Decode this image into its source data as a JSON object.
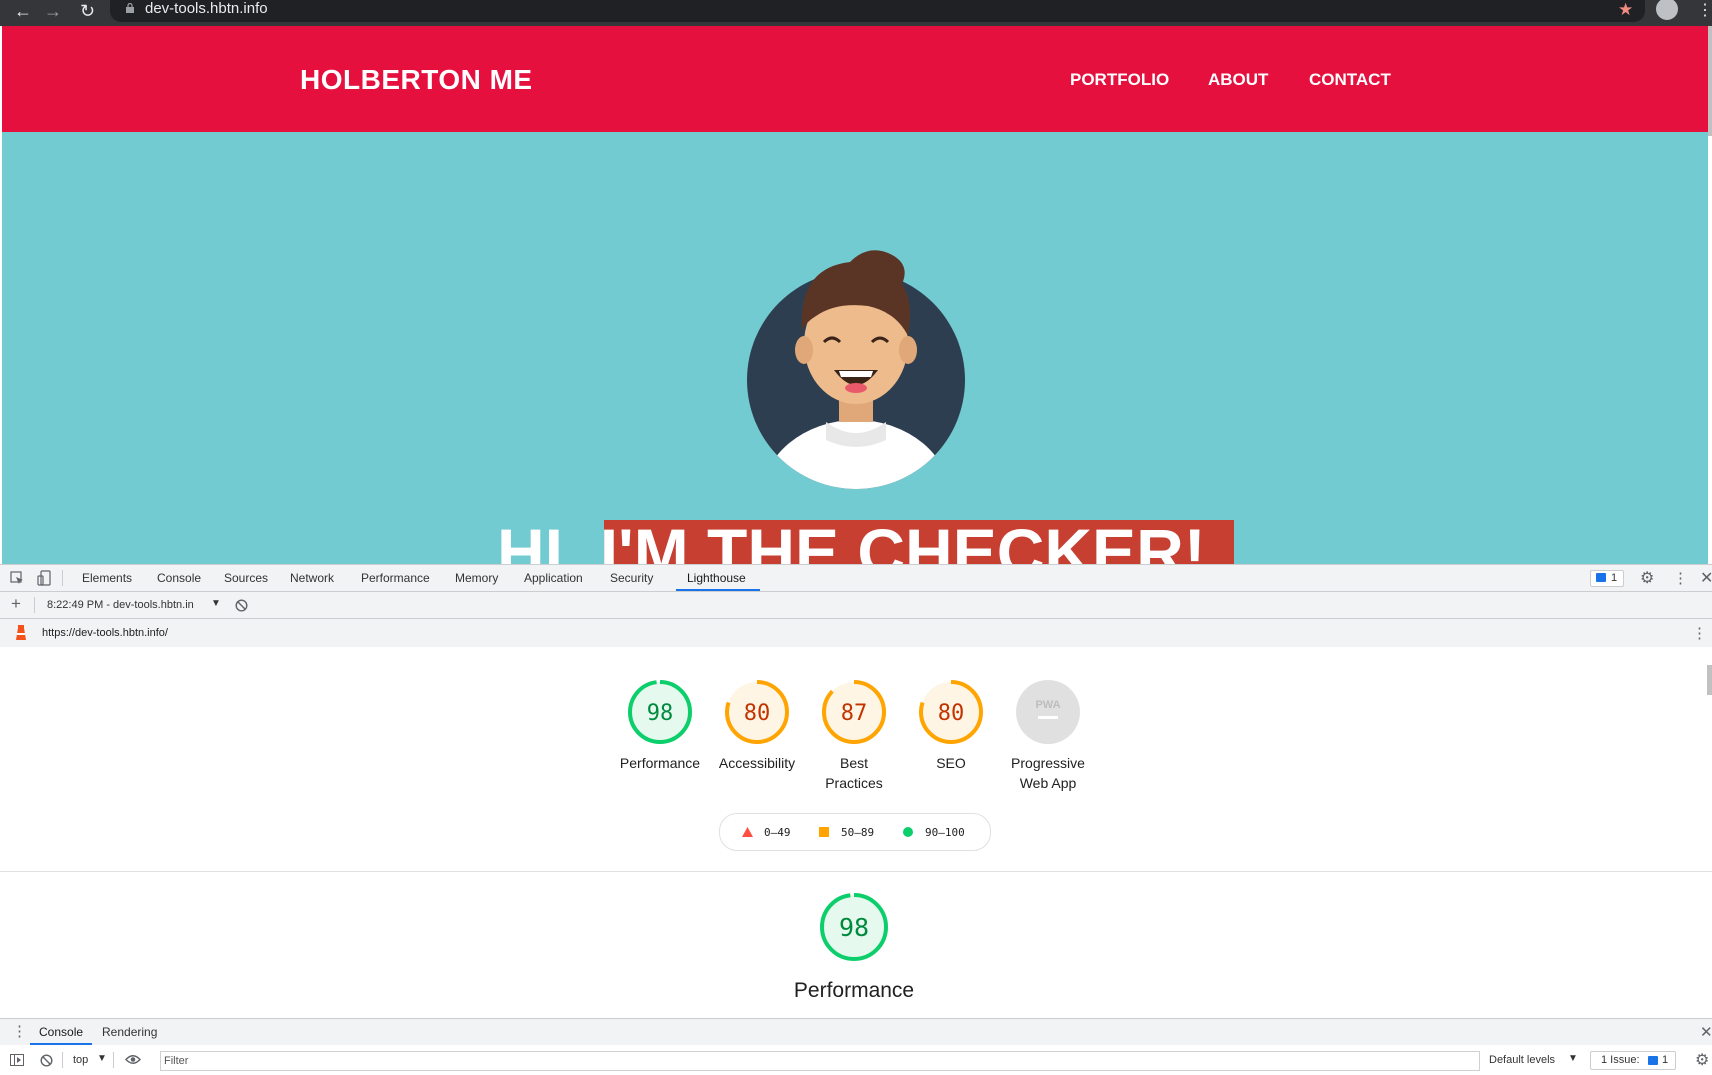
{
  "browser": {
    "url": "dev-tools.hbtn.info",
    "nav": {
      "back": "←",
      "forward": "→",
      "reload": "↻"
    }
  },
  "site": {
    "logo": "HOLBERTON ME",
    "nav": [
      "PORTFOLIO",
      "ABOUT",
      "CONTACT"
    ],
    "hero_part1": "HI, ",
    "hero_part2": "I'M THE CHECKER!",
    "colors": {
      "header": "#e5103e",
      "hero_bg": "#72cbd1",
      "highlight": "#c63f31"
    }
  },
  "devtools": {
    "tabs": [
      "Elements",
      "Console",
      "Sources",
      "Network",
      "Performance",
      "Memory",
      "Application",
      "Security",
      "Lighthouse"
    ],
    "active_tab": "Lighthouse",
    "issues_badge": "1",
    "report_selector": "8:22:49 PM - dev-tools.hbtn.in",
    "report_url": "https://dev-tools.hbtn.info/",
    "scores": [
      {
        "label_line1": "Performance",
        "label_line2": "",
        "value": 98,
        "display": "98",
        "color": "#0cce6b",
        "bg": "#e6f9ef"
      },
      {
        "label_line1": "Accessibility",
        "label_line2": "",
        "value": 80,
        "display": "80",
        "color": "#ffa400",
        "bg": "#fff5e5"
      },
      {
        "label_line1": "Best",
        "label_line2": "Practices",
        "value": 87,
        "display": "87",
        "color": "#ffa400",
        "bg": "#fff5e5"
      },
      {
        "label_line1": "SEO",
        "label_line2": "",
        "value": 80,
        "display": "80",
        "color": "#ffa400",
        "bg": "#fff5e5"
      },
      {
        "label_line1": "Progressive",
        "label_line2": "Web App",
        "value": null,
        "display": "PWA",
        "color": "#9e9e9e",
        "bg": "#e0e0e0"
      }
    ],
    "legend": [
      {
        "range": "0–49",
        "color": "#ff4e42",
        "shape": "triangle"
      },
      {
        "range": "50–89",
        "color": "#ffa400",
        "shape": "square"
      },
      {
        "range": "90–100",
        "color": "#0cce6b",
        "shape": "circle"
      }
    ],
    "performance_section": {
      "value": 98,
      "display": "98",
      "title": "Performance"
    },
    "drawer": {
      "tabs": [
        "Console",
        "Rendering"
      ],
      "context": "top",
      "filter_placeholder": "Filter",
      "levels": "Default levels",
      "issues_label": "1 Issue:",
      "issues_count": "1"
    }
  }
}
